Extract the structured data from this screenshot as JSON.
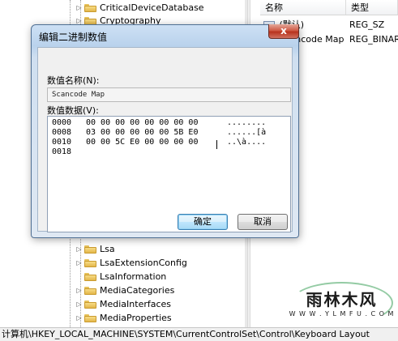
{
  "tree": {
    "items_above": [
      "CriticalDeviceDatabase",
      "Cryptography"
    ],
    "items_below": [
      "Lsa",
      "LsaExtensionConfig",
      "LsaInformation",
      "MediaCategories",
      "MediaInterfaces",
      "MediaProperties"
    ]
  },
  "values_pane": {
    "col_name": "名称",
    "col_type": "类型",
    "rows": [
      {
        "name": "(默认)",
        "type": "REG_SZ"
      },
      {
        "name": "Scancode Map",
        "type": "REG_BINARY"
      }
    ]
  },
  "dialog": {
    "title": "编辑二进制数值",
    "close_glyph": "x",
    "name_label": "数值名称(N):",
    "name_value": "Scancode Map",
    "data_label": "数值数据(V):",
    "hex_rows": [
      {
        "offset": "0000",
        "bytes": "00 00 00 00 00 00 00 00",
        "ascii": "........"
      },
      {
        "offset": "0008",
        "bytes": "03 00 00 00 00 00 5B E0",
        "ascii": "......[à"
      },
      {
        "offset": "0010",
        "bytes": "00 00 5C E0 00 00 00 00",
        "ascii": "..\\à...."
      },
      {
        "offset": "0018",
        "bytes": "",
        "ascii": ""
      }
    ],
    "ok_label": "确定",
    "cancel_label": "取消"
  },
  "statusbar": {
    "path": "计算机\\HKEY_LOCAL_MACHINE\\SYSTEM\\CurrentControlSet\\Control\\Keyboard Layout"
  },
  "watermark": {
    "text": "雨林木风",
    "url": "W W W . Y L M F U . C O M"
  }
}
